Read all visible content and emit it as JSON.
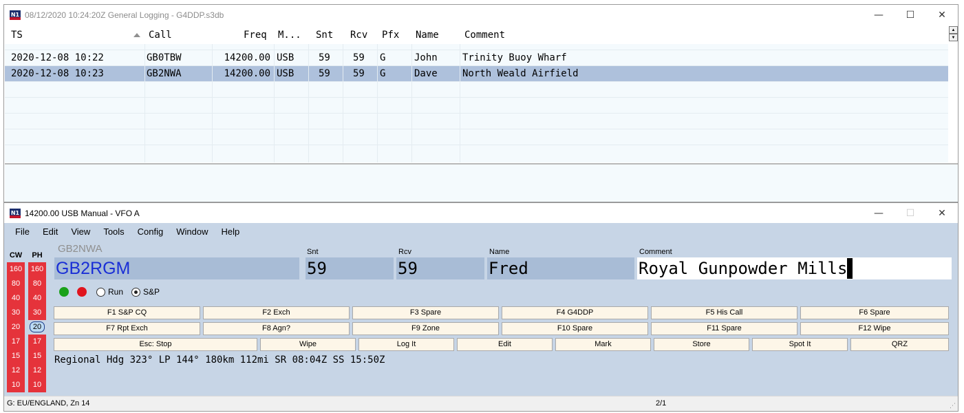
{
  "log_window": {
    "title": "08/12/2020 10:24:20Z  General Logging - G4DDP.s3db",
    "icon": "n1mm-logo-icon",
    "columns": [
      "TS",
      "Call",
      "Freq",
      "M...",
      "Snt",
      "Rcv",
      "Pfx",
      "Name",
      "Comment"
    ],
    "rows": [
      {
        "ts": "2020-12-08 10:22",
        "call": "GB0TBW",
        "freq": "14200.00",
        "mode": "USB",
        "snt": "59",
        "rcv": "59",
        "pfx": "G",
        "name": "John",
        "comment": "Trinity Buoy Wharf",
        "selected": false
      },
      {
        "ts": "2020-12-08 10:23",
        "call": "GB2NWA",
        "freq": "14200.00",
        "mode": "USB",
        "snt": "59",
        "rcv": "59",
        "pfx": "G",
        "name": "Dave",
        "comment": "North Weald Airfield",
        "selected": true
      }
    ],
    "window_buttons": {
      "minimize": "—",
      "maximize": "☐",
      "close": "✕"
    }
  },
  "entry_window": {
    "title": "14200.00 USB Manual - VFO A",
    "window_buttons": {
      "minimize": "—",
      "maximize": "☐",
      "close": "✕"
    },
    "menu": [
      "File",
      "Edit",
      "View",
      "Tools",
      "Config",
      "Window",
      "Help"
    ],
    "bands": {
      "cw_label": "CW",
      "ph_label": "PH",
      "list": [
        "160",
        "80",
        "40",
        "30",
        "20",
        "17",
        "15",
        "12",
        "10"
      ],
      "selected_ph": "20"
    },
    "fields": {
      "last_call": "GB2NWA",
      "call": "GB2RGM",
      "snt_label": "Snt",
      "snt": "59",
      "rcv_label": "Rcv",
      "rcv": "59",
      "name_label": "Name",
      "name": "Fred",
      "comment_label": "Comment",
      "comment": "Royal Gunpowder Mills"
    },
    "indicators": {
      "green": "#1aa11a",
      "red": "#e0141e"
    },
    "mode_radio": {
      "run_label": "Run",
      "sp_label": "S&P",
      "selected": "S&P"
    },
    "function_keys_row1": [
      "F1 S&P CQ",
      "F2 Exch",
      "F3 Spare",
      "F4 G4DDP",
      "F5 His Call",
      "F6 Spare"
    ],
    "function_keys_row2": [
      "F7 Rpt Exch",
      "F8 Agn?",
      "F9 Zone",
      "F10 Spare",
      "F11 Spare",
      "F12 Wipe"
    ],
    "action_buttons": [
      "Esc: Stop",
      "Wipe",
      "Log It",
      "Edit",
      "Mark",
      "Store",
      "Spot It",
      "QRZ"
    ],
    "info_line": "Regional Hdg 323° LP 144° 180km 112mi SR 08:04Z SS 15:50Z",
    "status_left": "G: EU/ENGLAND, Zn 14",
    "status_right": "2/1"
  },
  "colors": {
    "entry_background": "#c7d5e6",
    "band_red": "#e5333b",
    "selected_row": "#aec1dc",
    "call_text": "#1a2fd6",
    "function_key": "#fdf6e8"
  }
}
